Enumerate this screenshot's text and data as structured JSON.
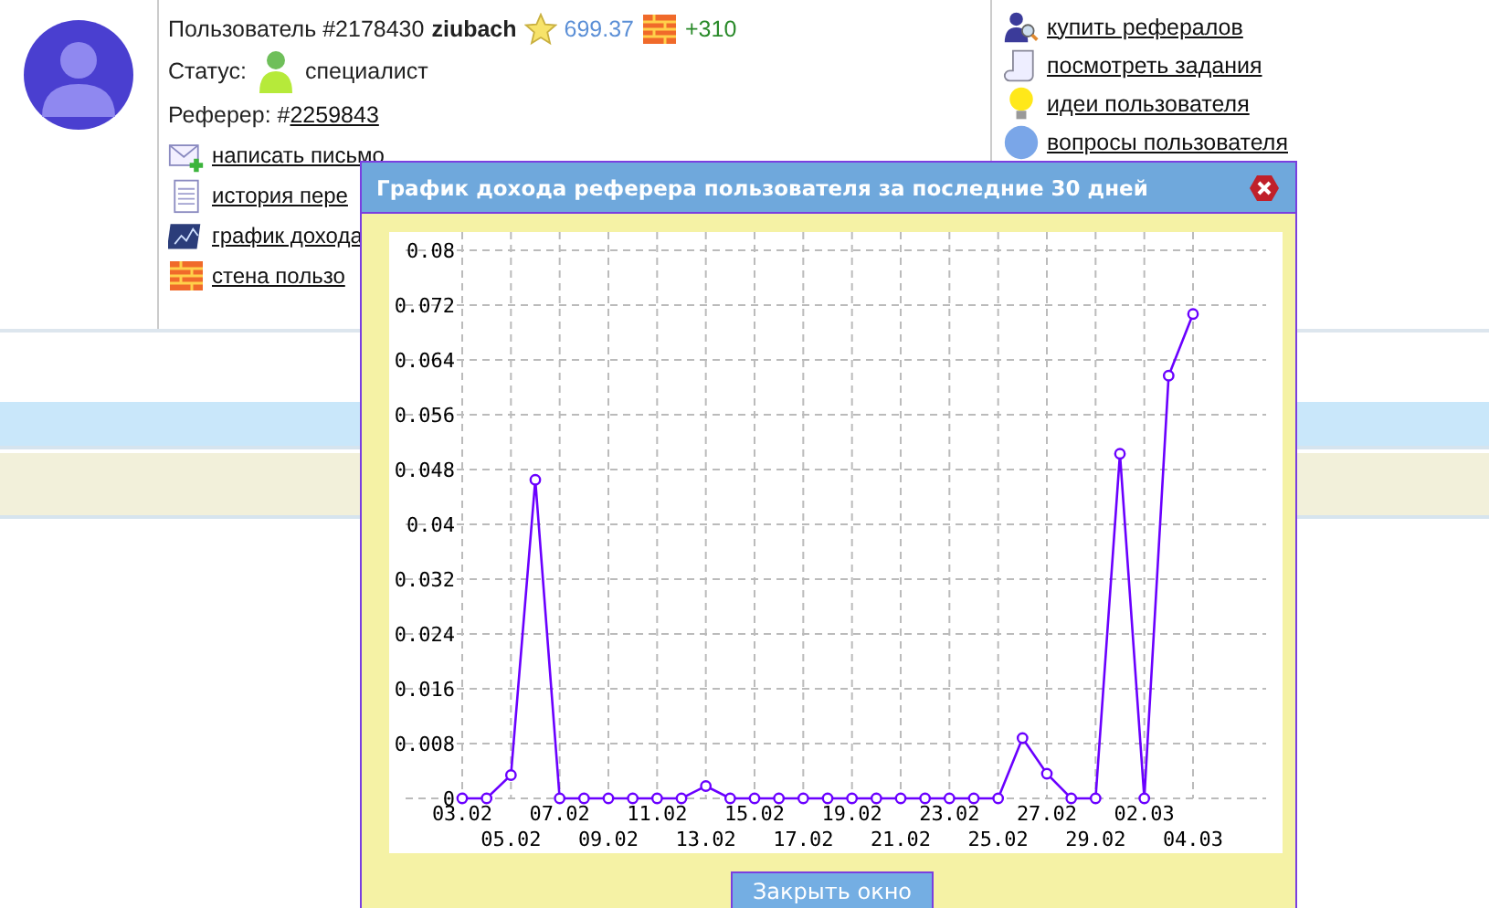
{
  "profile": {
    "user_label": "Пользователь #2178430",
    "username": "ziubach",
    "rating": "699.37",
    "bonus": "+310",
    "status_label": "Статус:",
    "status": "специалист",
    "referer_label": "Реферер: #",
    "referer": "2259843"
  },
  "left_links": [
    {
      "label": "написать письмо"
    },
    {
      "label": "история пере"
    },
    {
      "label": "график дохода"
    },
    {
      "label": "стена пользо"
    }
  ],
  "right_links": [
    {
      "label": "купить рефералов"
    },
    {
      "label": "посмотреть задания"
    },
    {
      "label": "идеи пользователя"
    },
    {
      "label": "вопросы пользователя"
    }
  ],
  "modal": {
    "title": "График дохода реферера пользователя за последние 30 дней",
    "close_button": "Закрыть окно",
    "chart_data": {
      "type": "line",
      "categories": [
        "03.02",
        null,
        "05.02",
        null,
        "07.02",
        null,
        "09.02",
        null,
        "11.02",
        null,
        "13.02",
        null,
        "15.02",
        null,
        "17.02",
        null,
        "19.02",
        null,
        "21.02",
        null,
        "23.02",
        null,
        "25.02",
        null,
        "27.02",
        null,
        "29.02",
        null,
        "02.03",
        null,
        "04.03"
      ],
      "grid": true,
      "series": [
        {
          "color": "#6a00ff",
          "marker": true,
          "values": [
            0,
            0,
            0.0034,
            0.0465,
            0,
            0,
            0,
            0,
            0,
            0,
            0.0018,
            0,
            0,
            0,
            0,
            0,
            0,
            0,
            0,
            0,
            0,
            0,
            0,
            0.0088,
            0.0036,
            0,
            0,
            0.0503,
            0,
            0.0617,
            0.0707
          ]
        }
      ],
      "yticks": [
        0,
        0.008,
        0.016,
        0.024,
        0.032,
        0.04,
        0.048,
        0.056,
        0.064,
        0.072,
        0.08
      ],
      "ylim": [
        0,
        0.08
      ]
    }
  }
}
